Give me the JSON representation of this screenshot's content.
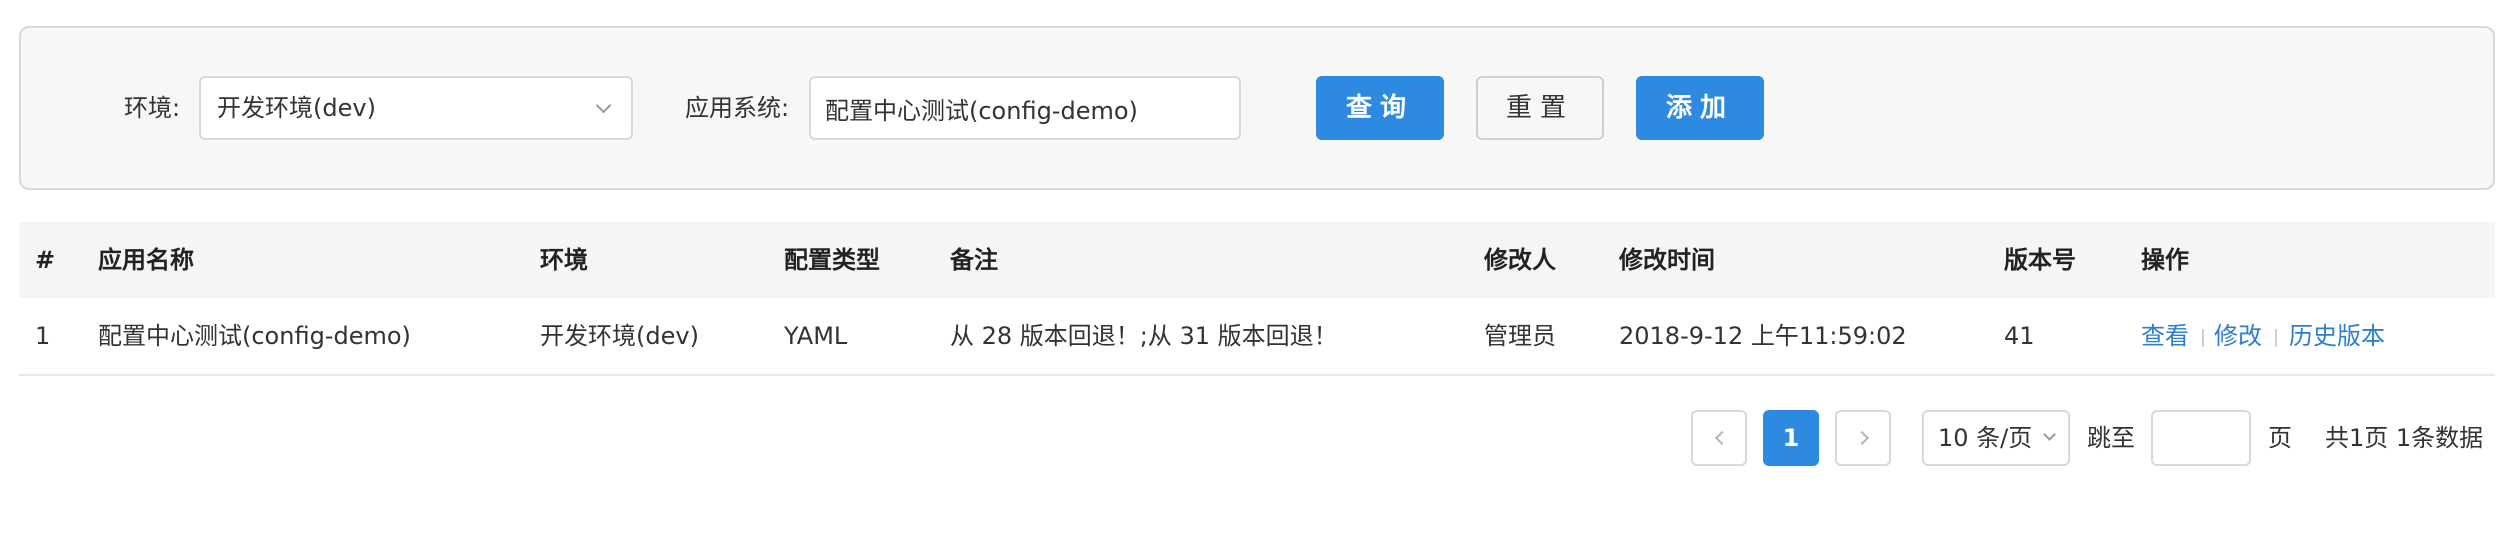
{
  "filters": {
    "env_label": "环境:",
    "env_value": "开发环境(dev)",
    "app_label": "应用系统:",
    "app_value": "配置中心测试(config-demo)",
    "query_button": "查询",
    "reset_button": "重置",
    "add_button": "添加"
  },
  "table": {
    "columns": [
      "#",
      "应用名称",
      "环境",
      "配置类型",
      "备注",
      "修改人",
      "修改时间",
      "版本号",
      "操作"
    ],
    "rows": [
      {
        "index": "1",
        "app_name": "配置中心测试(config-demo)",
        "env": "开发环境(dev)",
        "config_type": "YAML",
        "remark": "从 28 版本回退！;从 31 版本回退！",
        "modifier": "管理员",
        "modified_time": "2018-9-12 上午11:59:02",
        "version": "41",
        "actions": [
          "查看",
          "修改",
          "历史版本"
        ]
      }
    ]
  },
  "pagination": {
    "current_page": "1",
    "page_size_option": "10 条/页",
    "jump_label": "跳至",
    "jump_value": "",
    "page_unit": "页",
    "summary": "共1页 1条数据"
  },
  "colors": {
    "primary": "#2e8ae0",
    "link": "#2e7dd1",
    "panel_bg": "#f7f7f7",
    "header_bg": "#f5f5f5"
  }
}
